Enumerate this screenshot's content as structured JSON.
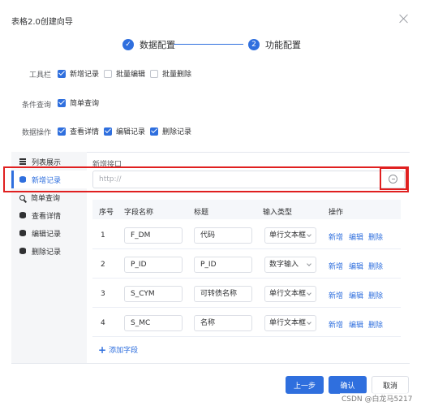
{
  "dialog": {
    "title": "表格2.0创建向导"
  },
  "stepper": {
    "step1": {
      "icon": "check-icon",
      "label": "数据配置"
    },
    "step2": {
      "number": "2",
      "label": "功能配置"
    }
  },
  "toolbar": {
    "label": "工具栏",
    "options": [
      {
        "label": "新增记录",
        "checked": true
      },
      {
        "label": "批量编辑",
        "checked": false
      },
      {
        "label": "批量删除",
        "checked": false
      }
    ]
  },
  "query": {
    "label": "条件查询",
    "options": [
      {
        "label": "简单查询",
        "checked": true
      }
    ]
  },
  "data_ops": {
    "label": "数据操作",
    "options": [
      {
        "label": "查看详情",
        "checked": true
      },
      {
        "label": "编辑记录",
        "checked": true
      },
      {
        "label": "删除记录",
        "checked": true
      }
    ]
  },
  "sidebar": {
    "items": [
      {
        "label": "列表展示",
        "icon": "list-icon"
      },
      {
        "label": "新增记录",
        "icon": "database-icon",
        "active": true
      },
      {
        "label": "简单查询",
        "icon": "search-icon"
      },
      {
        "label": "查看详情",
        "icon": "database-icon"
      },
      {
        "label": "编辑记录",
        "icon": "database-icon"
      },
      {
        "label": "删除记录",
        "icon": "database-icon"
      }
    ]
  },
  "api": {
    "label": "新增接口",
    "value": "http://"
  },
  "table": {
    "headers": [
      "序号",
      "字段名称",
      "标题",
      "输入类型",
      "操作"
    ],
    "rows": [
      {
        "index": "1",
        "field": "F_DM",
        "title": "代码",
        "type": "单行文本框"
      },
      {
        "index": "2",
        "field": "P_ID",
        "title": "P_ID",
        "type": "数字输入"
      },
      {
        "index": "3",
        "field": "S_CYM",
        "title": "可转债名称",
        "type": "单行文本框"
      },
      {
        "index": "4",
        "field": "S_MC",
        "title": "名称",
        "type": "单行文本框"
      }
    ],
    "actions": [
      "新增",
      "编辑",
      "删除"
    ],
    "add_field": "添加字段"
  },
  "footer": {
    "prev": "上一步",
    "confirm": "确认",
    "cancel": "取消"
  },
  "watermark": "CSDN @白龙马5217",
  "colors": {
    "primary": "#2f6fde",
    "highlight": "#e02020"
  }
}
